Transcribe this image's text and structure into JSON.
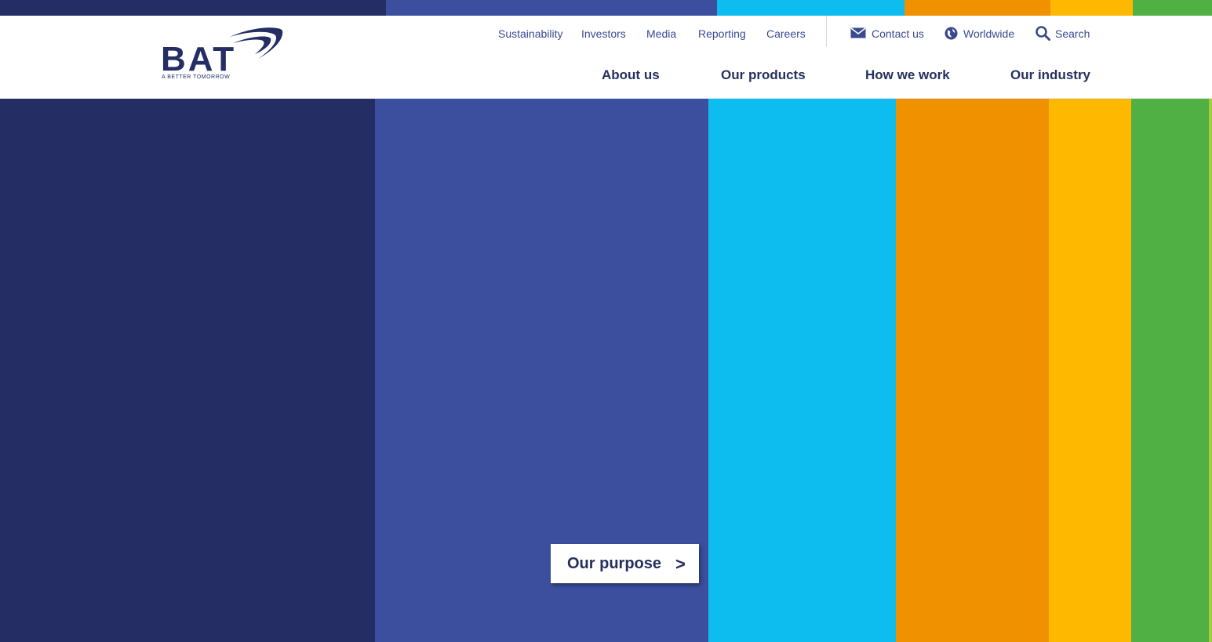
{
  "brand": {
    "name": "BAT",
    "tagline": "A BETTER TOMORROW"
  },
  "colors": {
    "navy": "#242e65",
    "royal": "#3b4f9e",
    "cyan": "#0ebdef",
    "orange": "#f09200",
    "amber": "#ffb800",
    "green": "#50b044",
    "lime": "#a6ce39",
    "text": "#25305f",
    "link": "#3a4a8f"
  },
  "utility_nav": {
    "sustainability": "Sustainability",
    "investors": "Investors",
    "media": "Media",
    "reporting": "Reporting",
    "careers": "Careers",
    "contact": "Contact us",
    "worldwide": "Worldwide",
    "search": "Search"
  },
  "icons": {
    "contact": "envelope-icon",
    "worldwide": "globe-icon",
    "search": "search-icon",
    "cta": "chevron-right-icon"
  },
  "main_nav": {
    "about": "About us",
    "products": "Our products",
    "how": "How we work",
    "industry": "Our industry"
  },
  "hero": {
    "cta_label": "Our purpose",
    "cta_arrow": ">"
  }
}
